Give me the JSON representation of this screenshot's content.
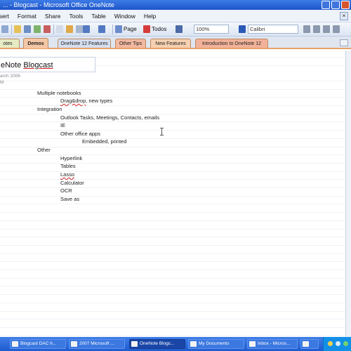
{
  "window": {
    "title": "Microsoft Office OneNote",
    "title_visible": "... - Blogcast - Microsoft Office OneNote"
  },
  "menubar": {
    "items": [
      "nsert",
      "Format",
      "Share",
      "Tools",
      "Table",
      "Window",
      "Help"
    ]
  },
  "toolbar": {
    "page_label": "Page",
    "todos_label": "Todos",
    "zoom_value": "100%",
    "font_value": "Calibri"
  },
  "tabs": [
    {
      "label": "otes",
      "color": "#e6ebc4"
    },
    {
      "label": "Demos",
      "color": "#f4c7a4",
      "active": true
    },
    {
      "label": "OneNote 12 Features",
      "color": "#d6dff0"
    },
    {
      "label": "Other Tips",
      "color": "#f3b8a0"
    },
    {
      "label": "New Features",
      "color": "#f6d0b0"
    },
    {
      "label": "Introduction to OneNote 12",
      "color": "#f2b29a"
    }
  ],
  "note": {
    "title_prefix": "eNote ",
    "title_underlined": "Blogcast",
    "date": "arch 2006",
    "time": "M",
    "lines": [
      {
        "text": "Multiple notebooks",
        "spell": ""
      },
      {
        "text": "",
        "spell": "Drag&drop",
        "suffix": ", new types"
      },
      {
        "text": "Integration",
        "spell": ""
      },
      {
        "text": "Outlook Tasks, Meetings, Contacts, emails",
        "spell": ""
      },
      {
        "text": "IE",
        "spell": ""
      },
      {
        "text": "Other office apps",
        "spell": ""
      },
      {
        "text": "Embedded, printed",
        "spell": ""
      },
      {
        "text": "Other",
        "spell": ""
      },
      {
        "text": "Hyperlink",
        "spell": ""
      },
      {
        "text": "Tables",
        "spell": ""
      },
      {
        "text": "",
        "spell": "Lasso",
        "suffix": ""
      },
      {
        "text": "Calculator",
        "spell": ""
      },
      {
        "text": "OCR",
        "spell": ""
      },
      {
        "text": "Save as",
        "spell": ""
      }
    ]
  },
  "taskbar": {
    "items": [
      "Blogcast DAC h...",
      "2007 Microsoft ...",
      "OneNote Blogc...",
      "My Documents",
      "Inbox - Micros...",
      ""
    ]
  },
  "colors": {
    "titlebar": "#1d55c9",
    "tab_border": "#e8a268",
    "spell_underline": "#d02020",
    "taskbar": "#1e5bd0"
  }
}
